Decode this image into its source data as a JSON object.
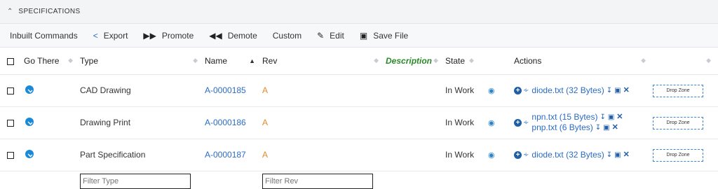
{
  "section": {
    "title": "SPECIFICATIONS",
    "chevron_icon": "chevron-up-icon"
  },
  "toolbar": {
    "inbuilt": "Inbuilt Commands",
    "export": "Export",
    "promote": "Promote",
    "demote": "Demote",
    "custom": "Custom",
    "edit": "Edit",
    "save_file": "Save File"
  },
  "table": {
    "headers": {
      "go_there": "Go There",
      "type": "Type",
      "name": "Name",
      "rev": "Rev",
      "description": "Description",
      "state": "State",
      "actions": "Actions"
    },
    "rows": [
      {
        "type": "CAD Drawing",
        "name": "A-0000185",
        "rev": "A",
        "state": "In Work",
        "files": [
          "diode.txt (32 Bytes)"
        ],
        "dropzone": "Drop Zone"
      },
      {
        "type": "Drawing Print",
        "name": "A-0000186",
        "rev": "A",
        "state": "In Work",
        "files": [
          "npn.txt (15 Bytes)",
          "pnp.txt (6 Bytes)"
        ],
        "dropzone": "Drop Zone"
      },
      {
        "type": "Part Specification",
        "name": "A-0000187",
        "rev": "A",
        "state": "In Work",
        "files": [
          "diode.txt (32 Bytes)"
        ],
        "dropzone": "Drop Zone"
      }
    ],
    "filters": {
      "type_placeholder": "Filter Type",
      "rev_placeholder": "Filter Rev"
    }
  },
  "colors": {
    "link": "#2a6cc4",
    "rev": "#e48a2b",
    "description_header": "#2a8a2a"
  }
}
